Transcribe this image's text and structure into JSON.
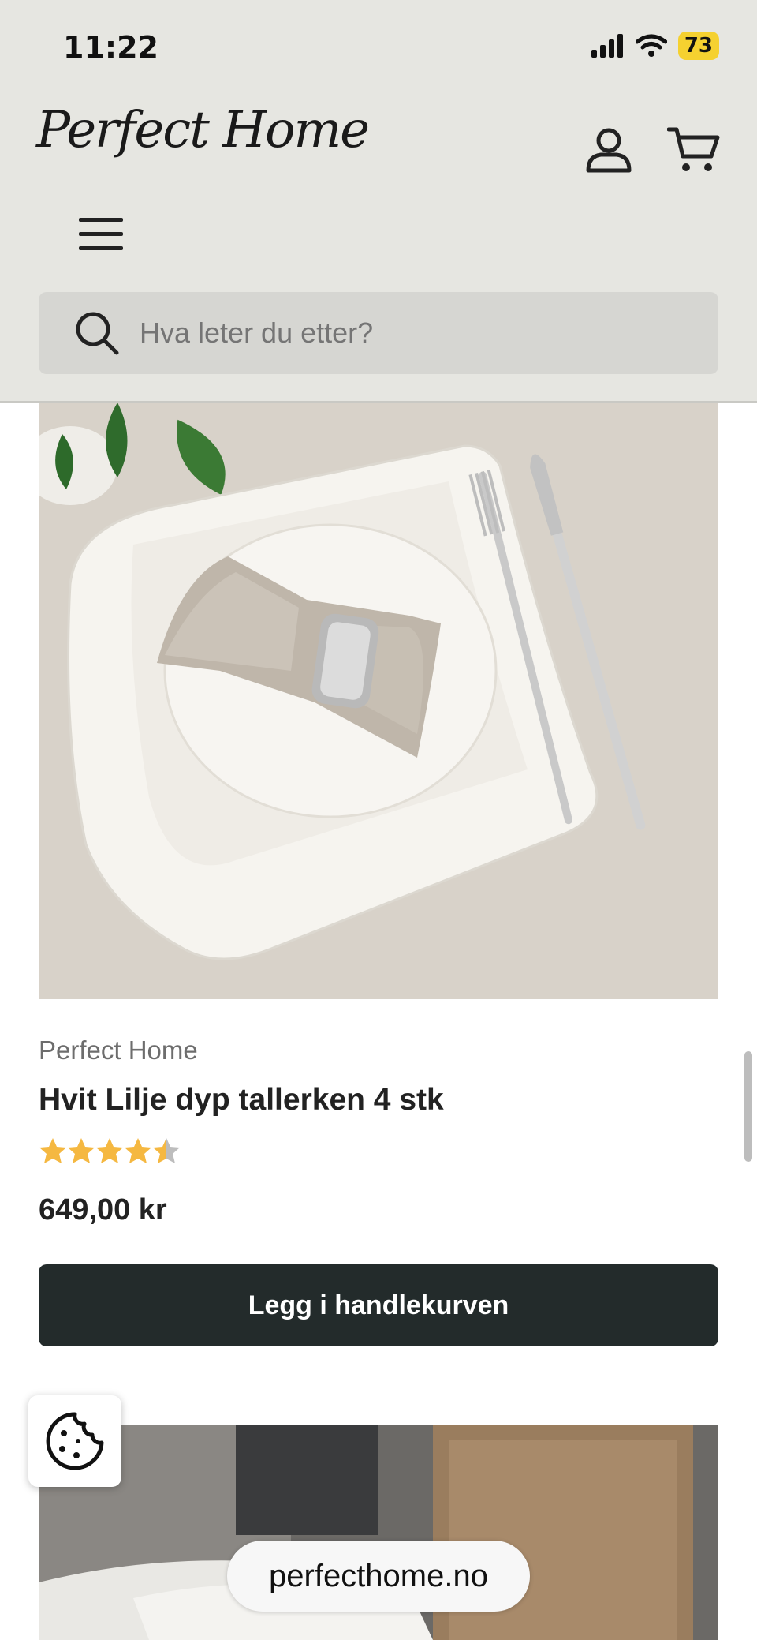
{
  "status_bar": {
    "time": "11:22",
    "battery": "73"
  },
  "header": {
    "logo_text": "Perfect Home",
    "search_placeholder": "Hva leter du etter?"
  },
  "product": {
    "brand": "Perfect Home",
    "title": "Hvit Lilje dyp tallerken 4 stk",
    "rating": 4.5,
    "price": "649,00 kr",
    "add_to_cart_label": "Legg i handlekurven"
  },
  "browser": {
    "url": "perfecthome.no"
  },
  "colors": {
    "header_bg": "#e6e6e1",
    "button_bg": "#232b2b",
    "star": "#f5b841"
  }
}
